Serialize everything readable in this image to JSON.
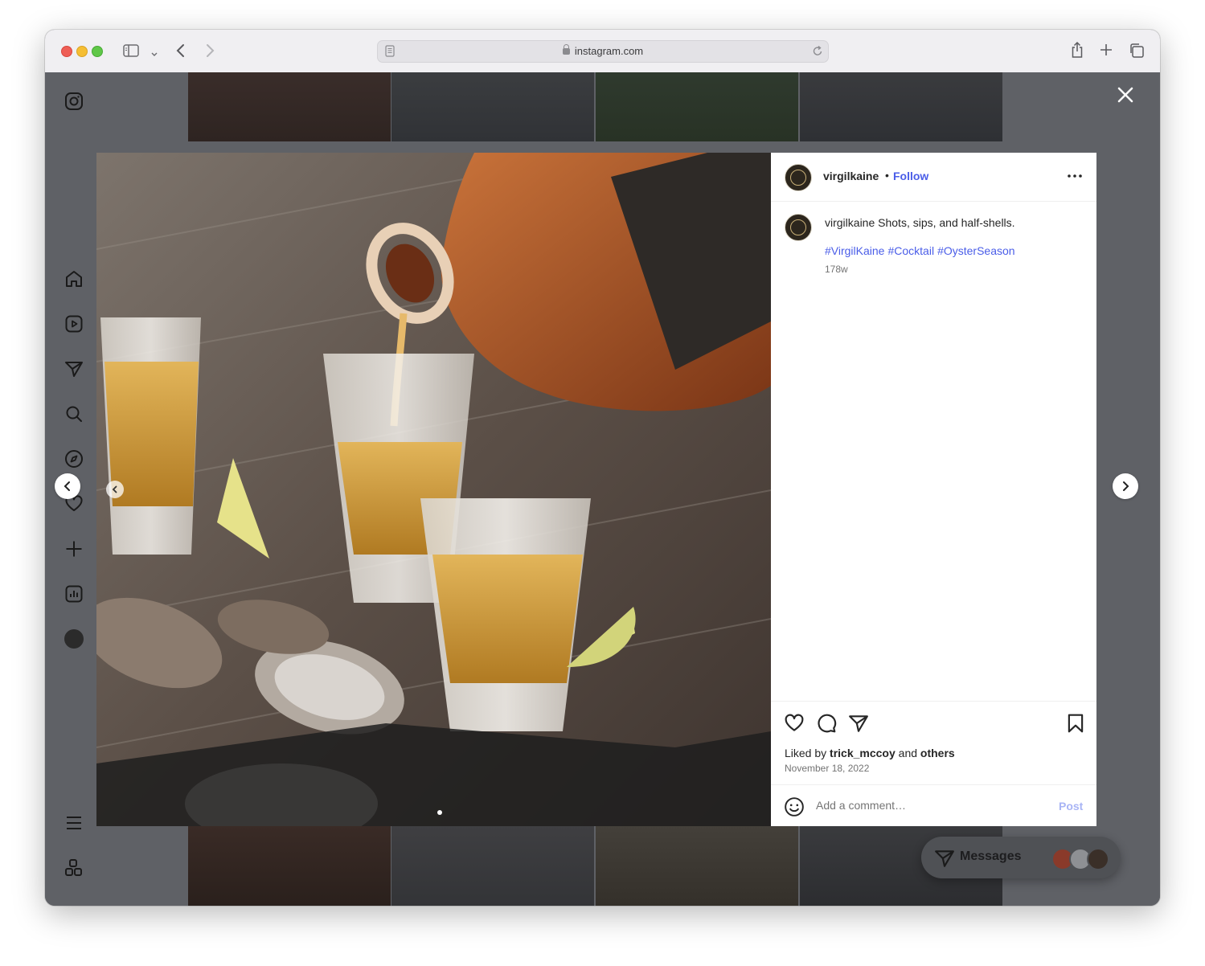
{
  "browser": {
    "url": "instagram.com"
  },
  "post": {
    "username": "virgilkaine",
    "separator": "•",
    "follow_label": "Follow",
    "caption_user": "virgilkaine",
    "caption_text": "Shots, sips, and half-shells.",
    "hashtags": [
      "#VirgilKaine",
      "#Cocktail",
      "#OysterSeason"
    ],
    "age": "178w",
    "liked_prefix": "Liked by",
    "liked_user": "trick_mccoy",
    "liked_and": "and",
    "liked_others": "others",
    "date": "November 18, 2022",
    "comment_placeholder": "Add a comment…",
    "post_label": "Post"
  },
  "messages": {
    "label": "Messages"
  },
  "sidebar": {
    "items": [
      "instagram-icon",
      "home-icon",
      "reels-icon",
      "direct-icon",
      "search-icon",
      "explore-icon",
      "heart-icon",
      "create-icon",
      "insights-icon",
      "profile-avatar",
      "menu-icon",
      "threads-icon"
    ]
  },
  "colors": {
    "link_blue": "#4a5de8",
    "overlay": "#5f6166"
  }
}
